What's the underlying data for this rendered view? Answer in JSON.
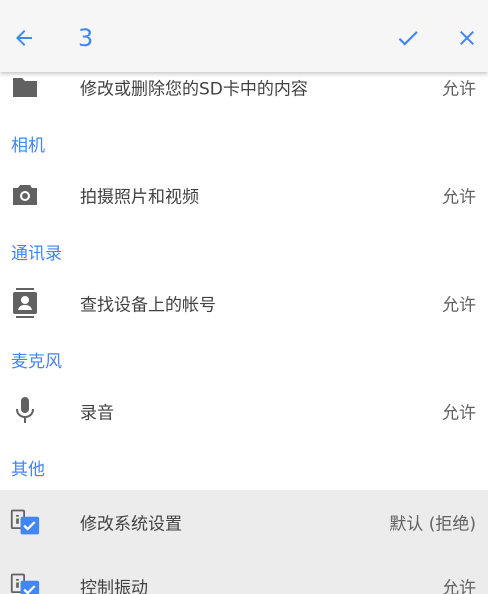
{
  "appbar": {
    "selected_count": "3",
    "back_icon": "arrow-left-icon",
    "confirm_icon": "check-icon",
    "close_icon": "close-icon",
    "accent": "#4285f4"
  },
  "partial_row": {
    "label": "修改或删除您的SD卡中的内容",
    "status": "允许",
    "icon": "folder-icon"
  },
  "sections": [
    {
      "header": "相机",
      "items": [
        {
          "label": "拍摄照片和视频",
          "status": "允许",
          "icon": "camera-icon"
        }
      ]
    },
    {
      "header": "通讯录",
      "items": [
        {
          "label": "查找设备上的帐号",
          "status": "允许",
          "icon": "contacts-icon"
        }
      ]
    },
    {
      "header": "麦克风",
      "items": [
        {
          "label": "录音",
          "status": "允许",
          "icon": "microphone-icon"
        }
      ]
    },
    {
      "header": "其他",
      "items": [
        {
          "label": "修改系统设置",
          "status": "默认 (拒绝)",
          "icon": "checked-info-icon",
          "selected": true
        },
        {
          "label": "控制振动",
          "status": "允许",
          "icon": "checked-info-icon",
          "selected": true
        }
      ]
    }
  ]
}
